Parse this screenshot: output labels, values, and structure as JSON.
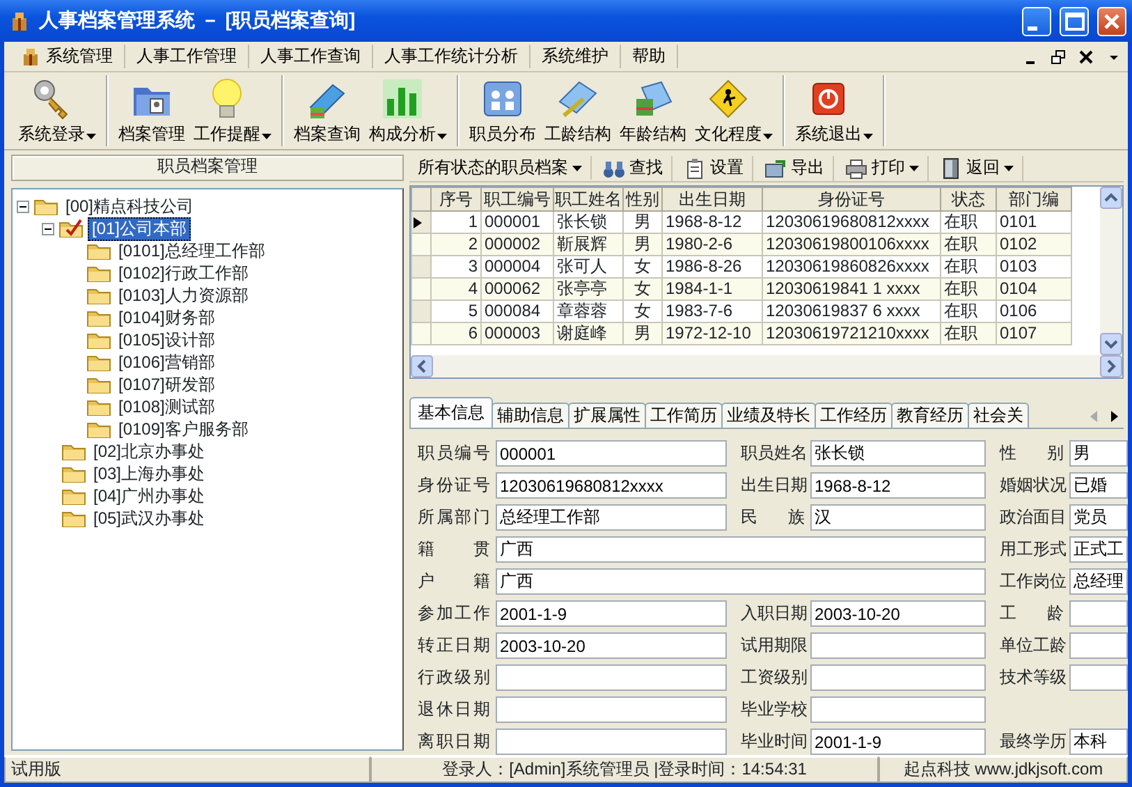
{
  "window": {
    "title": "人事档案管理系统 － [职员档案查询]"
  },
  "menu": [
    {
      "label": "系统管理"
    },
    {
      "label": "人事工作管理"
    },
    {
      "label": "人事工作查询"
    },
    {
      "label": "人事工作统计分析"
    },
    {
      "label": "系统维护"
    },
    {
      "label": "帮助"
    }
  ],
  "toolbar": {
    "groups": [
      [
        {
          "label": "系统登录",
          "dropdown": true
        }
      ],
      [
        {
          "label": "档案管理",
          "dropdown": false
        },
        {
          "label": "工作提醒",
          "dropdown": true
        }
      ],
      [
        {
          "label": "档案查询",
          "dropdown": false
        },
        {
          "label": "构成分析",
          "dropdown": true
        }
      ],
      [
        {
          "label": "职员分布",
          "dropdown": false
        },
        {
          "label": "工龄结构",
          "dropdown": false
        },
        {
          "label": "年龄结构",
          "dropdown": false
        },
        {
          "label": "文化程度",
          "dropdown": true
        }
      ],
      [
        {
          "label": "系统退出",
          "dropdown": true
        }
      ]
    ]
  },
  "left_panel": {
    "title": "职员档案管理",
    "tree": [
      {
        "label": "[00]精点科技公司",
        "selected": false,
        "expanded": true,
        "children": [
          {
            "label": "[01]公司本部",
            "selected": true,
            "expanded": true,
            "children": [
              {
                "label": "[0101]总经理工作部",
                "selected": false
              },
              {
                "label": "[0102]行政工作部",
                "selected": false
              },
              {
                "label": "[0103]人力资源部",
                "selected": false
              },
              {
                "label": "[0104]财务部",
                "selected": false
              },
              {
                "label": "[0105]设计部",
                "selected": false
              },
              {
                "label": "[0106]营销部",
                "selected": false
              },
              {
                "label": "[0107]研发部",
                "selected": false
              },
              {
                "label": "[0108]测试部",
                "selected": false
              },
              {
                "label": "[0109]客户服务部",
                "selected": false
              }
            ]
          },
          {
            "label": "[02]北京办事处",
            "selected": false
          },
          {
            "label": "[03]上海办事处",
            "selected": false
          },
          {
            "label": "[04]广州办事处",
            "selected": false
          },
          {
            "label": "[05]武汉办事处",
            "selected": false
          }
        ]
      }
    ]
  },
  "grid_toolbar": {
    "filter": "所有状态的职员档案",
    "buttons": [
      {
        "label": "查找",
        "dropdown": false
      },
      {
        "label": "设置",
        "dropdown": false
      },
      {
        "label": "导出",
        "dropdown": false
      },
      {
        "label": "打印",
        "dropdown": true
      },
      {
        "label": "返回",
        "dropdown": true
      }
    ]
  },
  "table": {
    "columns": [
      "序号",
      "职工编号",
      "职工姓名",
      "性别",
      "出生日期",
      "身份证号",
      "状态",
      "部门编"
    ],
    "rows": [
      {
        "selected": true,
        "cells": [
          "1",
          "000001",
          "张长锁",
          "男",
          "1968-8-12",
          "12030619680812xxxx",
          "在职",
          "0101"
        ]
      },
      {
        "selected": false,
        "cells": [
          "2",
          "000002",
          "靳展辉",
          "男",
          "1980-2-6",
          "12030619800106xxxx",
          "在职",
          "0102"
        ]
      },
      {
        "selected": false,
        "cells": [
          "3",
          "000004",
          "张可人",
          "女",
          "1986-8-26",
          "12030619860826xxxx",
          "在职",
          "0103"
        ]
      },
      {
        "selected": false,
        "cells": [
          "4",
          "000062",
          "张亭亭",
          "女",
          "1984-1-1",
          "12030619841 1 xxxx",
          "在职",
          "0104"
        ]
      },
      {
        "selected": false,
        "cells": [
          "5",
          "000084",
          "章蓉蓉",
          "女",
          "1983-7-6",
          "12030619837 6 xxxx",
          "在职",
          "0106"
        ]
      },
      {
        "selected": false,
        "cells": [
          "6",
          "000003",
          "谢庭峰",
          "男",
          "1972-12-10",
          "12030619721210xxxx",
          "在职",
          "0107"
        ]
      }
    ]
  },
  "tabs": [
    {
      "label": "基本信息",
      "selected": true
    },
    {
      "label": "辅助信息",
      "selected": false
    },
    {
      "label": "扩展属性",
      "selected": false
    },
    {
      "label": "工作简历",
      "selected": false
    },
    {
      "label": "业绩及特长",
      "selected": false
    },
    {
      "label": "工作经历",
      "selected": false
    },
    {
      "label": "教育经历",
      "selected": false
    },
    {
      "label": "社会关",
      "selected": false
    }
  ],
  "form": {
    "rows": [
      [
        {
          "label": "职员编号",
          "value": "000001"
        },
        {
          "label": "职员姓名",
          "value": "张长锁"
        },
        {
          "label": "性别",
          "value": "男"
        }
      ],
      [
        {
          "label": "身份证号",
          "value": "12030619680812xxxx"
        },
        {
          "label": "出生日期",
          "value": "1968-8-12"
        },
        {
          "label": "婚姻状况",
          "value": "已婚"
        }
      ],
      [
        {
          "label": "所属部门",
          "value": "总经理工作部"
        },
        {
          "label": "民族",
          "value": "汉"
        },
        {
          "label": "政治面目",
          "value": "党员"
        }
      ],
      [
        {
          "label": "籍贯",
          "value": "广西",
          "wide": true
        },
        {
          "label": "用工形式",
          "value": "正式工"
        }
      ],
      [
        {
          "label": "户籍",
          "value": "广西",
          "wide": true
        },
        {
          "label": "工作岗位",
          "value": "总经理"
        }
      ],
      [
        {
          "label": "参加工作",
          "value": "2001-1-9"
        },
        {
          "label": "入职日期",
          "value": "2003-10-20"
        },
        {
          "label": "工龄"
        }
      ],
      [
        {
          "label": "转正日期",
          "value": "2003-10-20"
        },
        {
          "label": "试用期限"
        },
        {
          "label": "单位工龄"
        }
      ],
      [
        {
          "label": "行政级别"
        },
        {
          "label": "工资级别"
        },
        {
          "label": "技术等级"
        }
      ],
      [
        {
          "label": "退休日期"
        },
        {
          "label": "毕业学校"
        }
      ],
      [
        {
          "label": "离职日期"
        },
        {
          "label": "毕业时间",
          "value": "2001-1-9"
        },
        {
          "label": "最终学历",
          "value": "本科"
        }
      ]
    ]
  },
  "status_bar": [
    "试用版",
    "登录人：[Admin]系统管理员 |登录时间：14:54:31",
    "起点科技 www.jdkjsoft.com"
  ]
}
